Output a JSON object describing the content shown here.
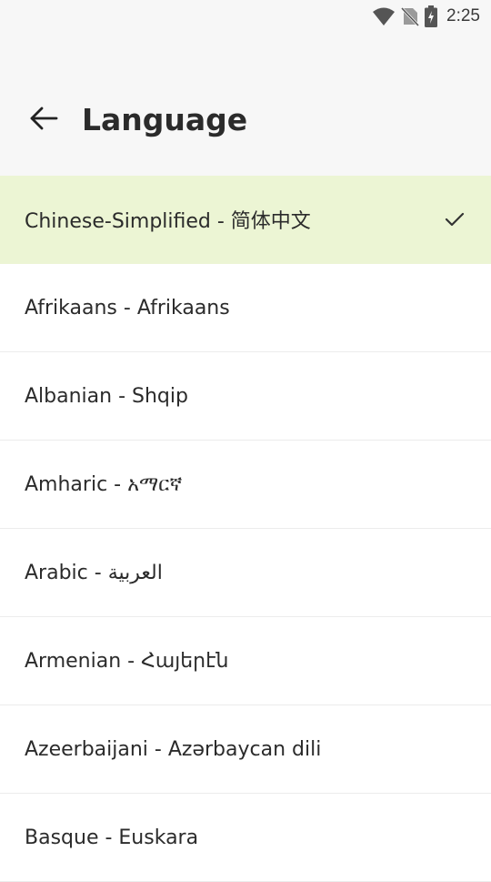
{
  "status_bar": {
    "time": "2:25",
    "icons": [
      "wifi-icon",
      "no-sim-icon",
      "battery-charging-icon"
    ]
  },
  "app_bar": {
    "title": "Language",
    "back_icon": "arrow-left-icon"
  },
  "languages": [
    {
      "label": "Chinese-Simplified - 简体中文",
      "selected": true
    },
    {
      "label": "Afrikaans - Afrikaans",
      "selected": false
    },
    {
      "label": "Albanian - Shqip",
      "selected": false
    },
    {
      "label": "Amharic - አማርኛ",
      "selected": false
    },
    {
      "label": "Arabic - العربية",
      "selected": false
    },
    {
      "label": "Armenian - Հայերէն",
      "selected": false
    },
    {
      "label": "Azeerbaijani - Azərbaycan dili",
      "selected": false
    },
    {
      "label": "Basque - Euskara",
      "selected": false
    }
  ],
  "colors": {
    "selected_bg": "#ecf5d4",
    "header_bg": "#f7f7f7",
    "text": "#2b2b2b"
  }
}
